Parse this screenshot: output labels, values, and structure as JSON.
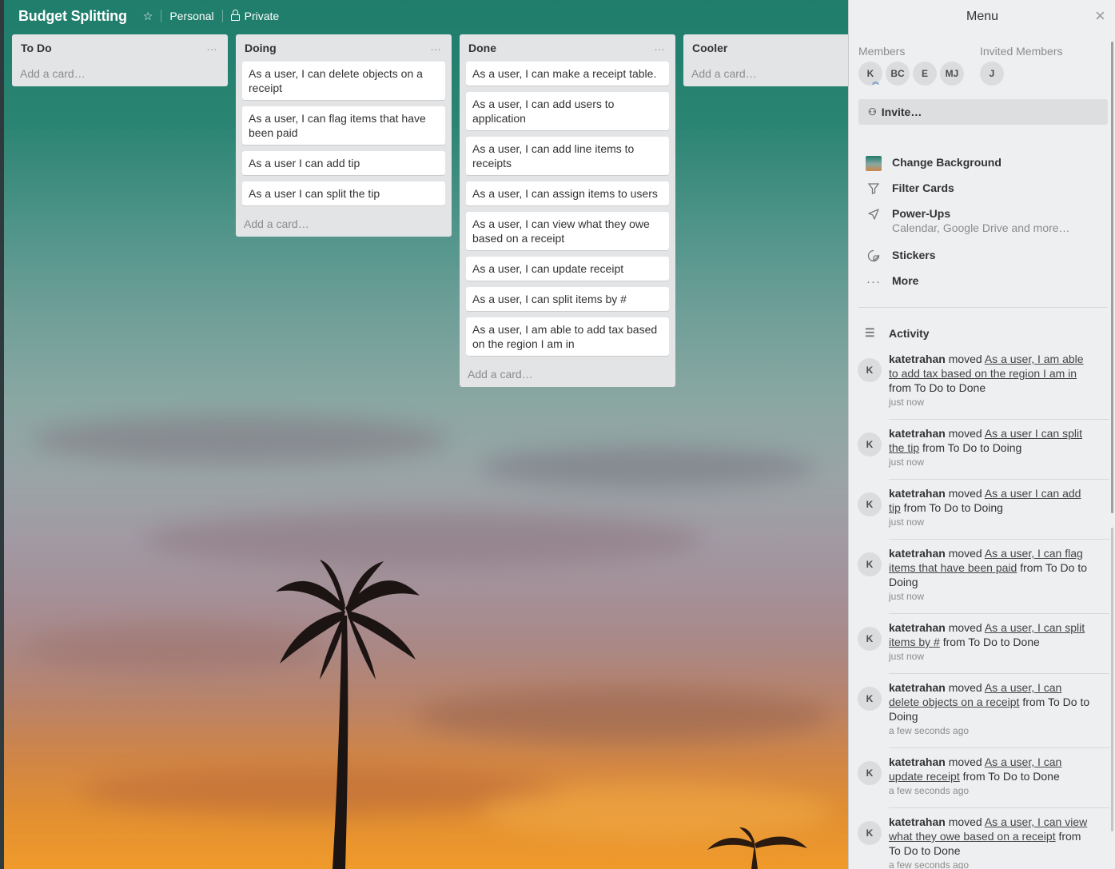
{
  "board": {
    "title": "Budget Splitting",
    "team": "Personal",
    "visibility": "Private",
    "star_icon": "star-icon",
    "lock_icon": "lock-icon"
  },
  "lists": [
    {
      "title": "To Do",
      "cards": [],
      "add_card": "Add a card…"
    },
    {
      "title": "Doing",
      "cards": [
        "As a user, I can delete objects on a receipt",
        "As a user, I can flag items that have been paid",
        "As a user I can add tip",
        "As a user I can split the tip"
      ],
      "add_card": "Add a card…"
    },
    {
      "title": "Done",
      "cards": [
        "As a user, I can make a receipt table.",
        "As a user, I can add users to application",
        "As a user, I can add line items to receipts",
        "As a user, I can assign items to users",
        "As a user, I can view what they owe based on a receipt",
        "As a user, I can update receipt",
        "As a user, I can split items by #",
        "As a user, I am able to add tax based on the region I am in"
      ],
      "add_card": "Add a card…"
    },
    {
      "title": "Cooler",
      "cards": [],
      "add_card": "Add a card…"
    }
  ],
  "list_menu_icon": "…",
  "menu": {
    "title": "Menu",
    "close_icon": "×",
    "members_label": "Members",
    "invited_label": "Invited Members",
    "members": [
      "K",
      "BC",
      "E",
      "MJ"
    ],
    "invited": [
      "J"
    ],
    "invite_label": "Invite…",
    "items": [
      {
        "label": "Change Background",
        "icon": "background-thumbnail-icon"
      },
      {
        "label": "Filter Cards",
        "icon": "filter-icon"
      },
      {
        "label": "Power-Ups",
        "sub": "Calendar, Google Drive and more…",
        "icon": "rocket-icon"
      },
      {
        "label": "Stickers",
        "icon": "sticker-icon"
      },
      {
        "label": "More",
        "icon": "ellipsis-icon"
      }
    ],
    "activity_label": "Activity",
    "activity": [
      {
        "avatar": "K",
        "user": "katetrahan",
        "verb": " moved ",
        "card": "As a user, I am able to add tax based on the region I am in",
        "rest": " from To Do to Done",
        "time": "just now"
      },
      {
        "avatar": "K",
        "user": "katetrahan",
        "verb": " moved ",
        "card": "As a user I can split the tip",
        "rest": " from To Do to Doing",
        "time": "just now"
      },
      {
        "avatar": "K",
        "user": "katetrahan",
        "verb": " moved ",
        "card": "As a user I can add tip",
        "rest": " from To Do to Doing",
        "time": "just now"
      },
      {
        "avatar": "K",
        "user": "katetrahan",
        "verb": " moved ",
        "card": "As a user, I can flag items that have been paid",
        "rest": " from To Do to Doing",
        "time": "just now"
      },
      {
        "avatar": "K",
        "user": "katetrahan",
        "verb": " moved ",
        "card": "As a user, I can split items by #",
        "rest": " from To Do to Done",
        "time": "just now"
      },
      {
        "avatar": "K",
        "user": "katetrahan",
        "verb": " moved ",
        "card": "As a user, I can delete objects on a receipt",
        "rest": " from To Do to Doing",
        "time": "a few seconds ago"
      },
      {
        "avatar": "K",
        "user": "katetrahan",
        "verb": " moved ",
        "card": "As a user, I can update receipt",
        "rest": " from To Do to Done",
        "time": "a few seconds ago"
      },
      {
        "avatar": "K",
        "user": "katetrahan",
        "verb": " moved ",
        "card": "As a user, I can view what they owe based on a receipt",
        "rest": " from To Do to Done",
        "time": "a few seconds ago"
      }
    ]
  },
  "colors": {
    "list_bg": "#e2e4e6",
    "menu_bg": "#edeff0",
    "sky_top": "#1f7d6b",
    "sky_bottom": "#f09a2a"
  }
}
